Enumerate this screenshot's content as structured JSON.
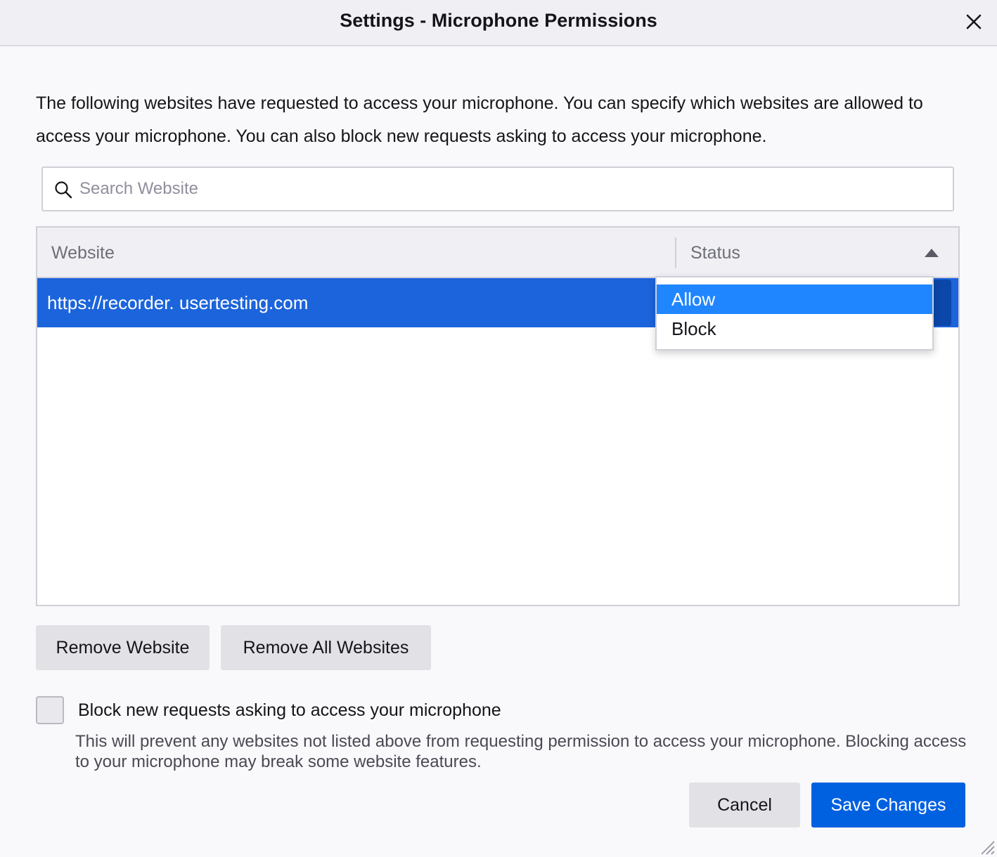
{
  "window": {
    "title": "Settings - Microphone Permissions",
    "close_icon": "close-icon"
  },
  "description": "The following websites have requested to access your microphone. You can specify which websites are allowed to access your microphone. You can also block new requests asking to access your microphone.",
  "search": {
    "placeholder": "Search Website",
    "value": "",
    "icon": "search-icon"
  },
  "table": {
    "columns": [
      "Website",
      "Status"
    ],
    "sort_icon": "sort-ascending-icon",
    "rows": [
      {
        "website": "https://recorder. usertesting.com",
        "status": "Allow",
        "selected": true
      }
    ]
  },
  "status_dropdown": {
    "options": [
      "Allow",
      "Block"
    ],
    "selected": "Allow"
  },
  "buttons": {
    "remove_website": "Remove Website",
    "remove_all_websites": "Remove All Websites",
    "cancel": "Cancel",
    "save_changes": "Save Changes"
  },
  "block_new_requests": {
    "checked": false,
    "label": "Block new requests asking to access your microphone",
    "helper": "This will prevent any websites not listed above from requesting permission to access your microphone. Blocking access to your microphone may break some website features."
  },
  "colors": {
    "accent": "#0061e0",
    "row_selected": "#1c64db",
    "dropdown_selected": "#1f86ff"
  }
}
